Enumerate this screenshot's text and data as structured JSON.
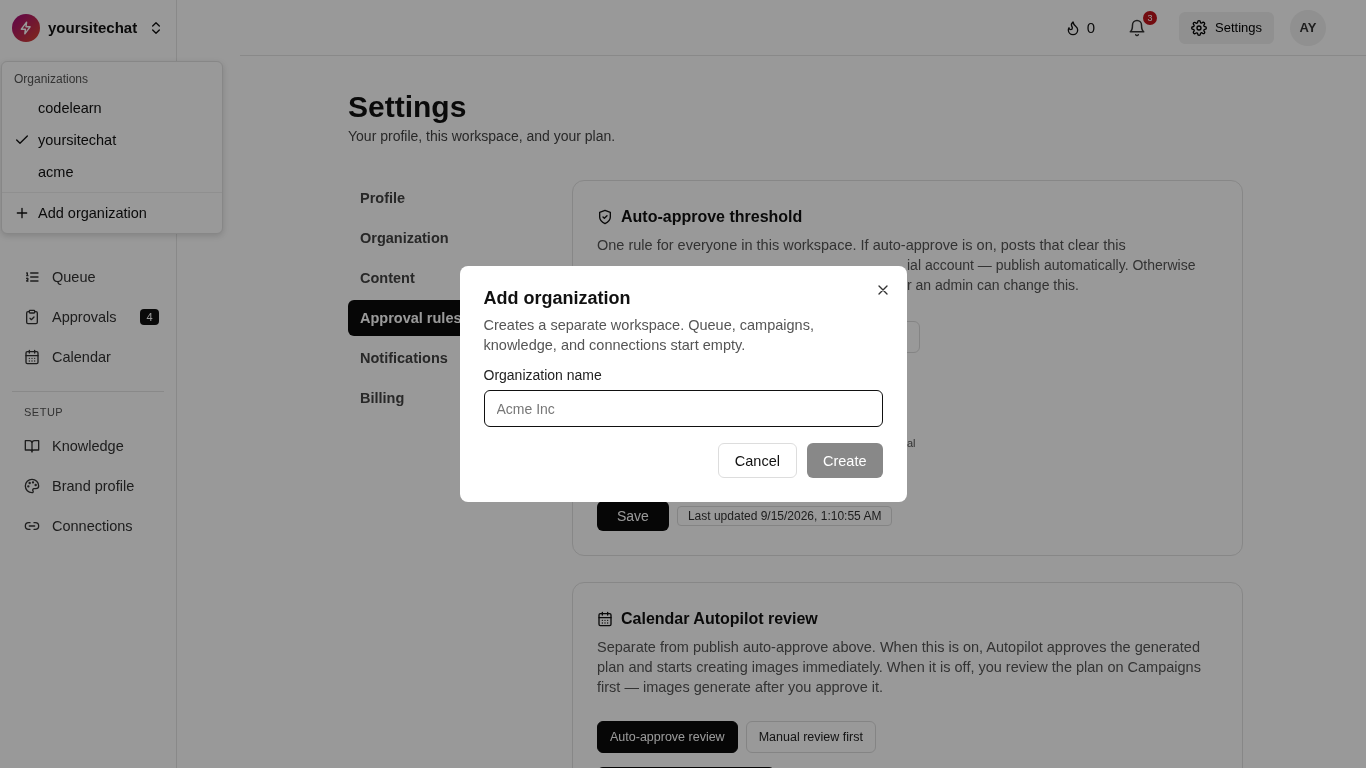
{
  "org_switcher": {
    "name": "yoursitechat"
  },
  "org_menu": {
    "heading": "Organizations",
    "items": [
      {
        "label": "codelearn",
        "selected": false
      },
      {
        "label": "yoursitechat",
        "selected": true
      },
      {
        "label": "acme",
        "selected": false
      }
    ],
    "add_label": "Add organization"
  },
  "sidebar": {
    "items": [
      {
        "label": "Queue"
      },
      {
        "label": "Approvals",
        "badge": "4"
      },
      {
        "label": "Calendar"
      }
    ],
    "section": "SETUP",
    "setup_items": [
      {
        "label": "Knowledge"
      },
      {
        "label": "Brand profile"
      },
      {
        "label": "Connections"
      }
    ]
  },
  "topbar": {
    "streak": "0",
    "notifications": "3",
    "settings": "Settings",
    "avatar": "AY"
  },
  "page": {
    "title": "Settings",
    "subtitle": "Your profile, this workspace, and your plan."
  },
  "tabs": [
    {
      "label": "Profile",
      "selected": false
    },
    {
      "label": "Organization",
      "selected": false
    },
    {
      "label": "Content",
      "selected": false
    },
    {
      "label": "Approval rules",
      "selected": true
    },
    {
      "label": "Notifications",
      "selected": false
    },
    {
      "label": "Billing",
      "selected": false
    }
  ],
  "threshold_card": {
    "title": "Auto-approve threshold",
    "text": "One rule for everyone in this workspace. If auto-approve is on, posts that clear this",
    "covered_lines": [
      "ial account — publish automatically. Otherwise",
      "r an admin can change this."
    ],
    "covered_note": "al",
    "save": "Save",
    "last_updated": "Last updated 9/15/2026, 1:10:55 AM"
  },
  "review_card": {
    "title": "Calendar Autopilot review",
    "text": "Separate from publish auto-approve above. When this is on, Autopilot approves the generated plan and starts creating images immediately. When it is off, you review the plan on Campaigns first — images generate after you approve it.",
    "options": [
      {
        "label": "Auto-approve review",
        "selected": true
      },
      {
        "label": "Manual review first",
        "selected": false
      }
    ]
  },
  "dialog": {
    "title": "Add organization",
    "description": "Creates a separate workspace. Queue, campaigns, knowledge, and connections start empty.",
    "field_label": "Organization name",
    "placeholder": "Acme Inc",
    "cancel": "Cancel",
    "create": "Create",
    "create_disabled": true
  }
}
